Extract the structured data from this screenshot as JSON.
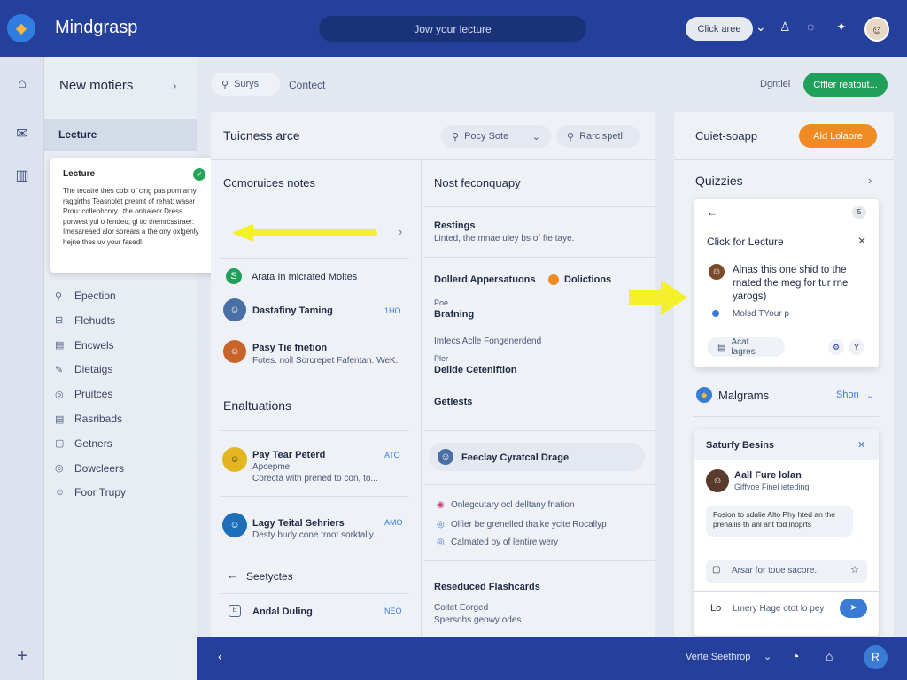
{
  "topbar": {
    "app_title": "Mindgrasp",
    "search_text": "Jow your lecture",
    "click_pill": "Click aree"
  },
  "rail": {
    "icons": [
      "home-icon",
      "mail-icon",
      "book-icon",
      "plus-icon"
    ]
  },
  "sidebar": {
    "header": "New motiers",
    "active_item": "Lecture",
    "items": [
      {
        "icon": "⚲",
        "label": "Epection"
      },
      {
        "icon": "⊟",
        "label": "Flehudts"
      },
      {
        "icon": "▤",
        "label": "Encwels"
      },
      {
        "icon": "✎",
        "label": "Dietaigs"
      },
      {
        "icon": "◎",
        "label": "Pruitces"
      },
      {
        "icon": "▤",
        "label": "Rasribads"
      },
      {
        "icon": "▢",
        "label": "Getners"
      },
      {
        "icon": "◎",
        "label": "Dowcleers"
      },
      {
        "icon": "☺",
        "label": "Foor Trupy"
      }
    ]
  },
  "popup": {
    "title": "Lecture",
    "body": "The tecatre thes cobi of clng pas pom amy raggirths Teasnplet presmt of rehat: waser Prou: collenhcnry., the onhaiecr Dress porwest yul o fendeu; gl tic themrcsstraer: Imesareaed alor sorears a the ony oxlgenly hejne thes uv your fasedl."
  },
  "toolbar": {
    "chip_search": "Surys",
    "tab_contact": "Contect",
    "link_detail": "Dgntiel",
    "green_btn": "Cffler reatbut..."
  },
  "main_panel": {
    "title": "Tuicness arce",
    "chip_sort": "Pocy Sote",
    "chip_search": "Rarclspetl"
  },
  "notes": {
    "header": "Ccmoruices notes",
    "row1": "Arata In micrated Moltes",
    "row2_title": "Dastafiny Taming",
    "row2_tag": "1HO",
    "row3_title": "Pasy Tie fnetion",
    "row3_sub": "Fotes. noll Sorcrepet Fafentan. WeK."
  },
  "enaluations": {
    "header": "Enaltuations",
    "row1_title": "Pay Tear Peterd",
    "row1_sub1": "Apcepme",
    "row1_sub2": "Corecta with prened to con, to...",
    "row1_tag": "ATO",
    "row2_title": "Lagy Teital Sehriers",
    "row2_sub": "Desty budy cone troot sorktally...",
    "row2_tag": "AMO",
    "back_label": "Seetyctes",
    "row3_title": "Andal Duling",
    "row3_tag": "NEO"
  },
  "geography": {
    "header": "Nost feconquapy",
    "r1_title": "Restings",
    "r1_sub": "Linted, the mnae uley bs of fte taye.",
    "r2_title": "Dollerd Appersatuons",
    "r2_badge": "Dolictions",
    "r3_pre": "Poe",
    "r3_title": "Brafning",
    "r4_pre": "Imfecs Aclle Fongenerdend",
    "r4_pre2": "Pler",
    "r4_title": "Delide Ceteniftion",
    "r5_title": "Getlests",
    "r6_title": "Feeclay Cyratcal Drage",
    "b1": "Onlegcutary ocl delltany fnation",
    "b2": "Olfier be grenelled thaike ycite Rocallyp",
    "b3": "Calmated oy of lentire wery",
    "fc_title": "Reseduced Flashcards",
    "fc1": "Coitet Eorged",
    "fc2": "Spersohs geowy odes"
  },
  "right": {
    "quick": "Cuiet-soapp",
    "add_btn": "Aid Lolaore",
    "quizzes": "Quizzies",
    "card_title": "Click for Lecture",
    "card_text": "Alnas this one shid to the rnated the meg for tur rne yarogs)",
    "card_meta": "Molsd TYour p",
    "card_btn": "Acat lagres",
    "malgrams": "Malgrams",
    "show": "Shon",
    "chat_header": "Saturfy Besins",
    "chat_name": "Aall Fure lolan",
    "chat_sub": "Giffvoe Finel ieteding",
    "chat_bubble": "Fosion to sdalie Alto Phy hted an the prenallis th anl ant tod lnoprts",
    "chat_field": "Arsar for toue sacore.",
    "chat_input": "Lmery Hage otot lo pey",
    "chat_lo": "Lo"
  },
  "bottom": {
    "label": "Verte Seethrop",
    "avatar": "R"
  },
  "colors": {
    "nav": "#24409a",
    "green": "#1fa05b",
    "orange": "#f08a22",
    "yellow": "#f4f02a"
  }
}
